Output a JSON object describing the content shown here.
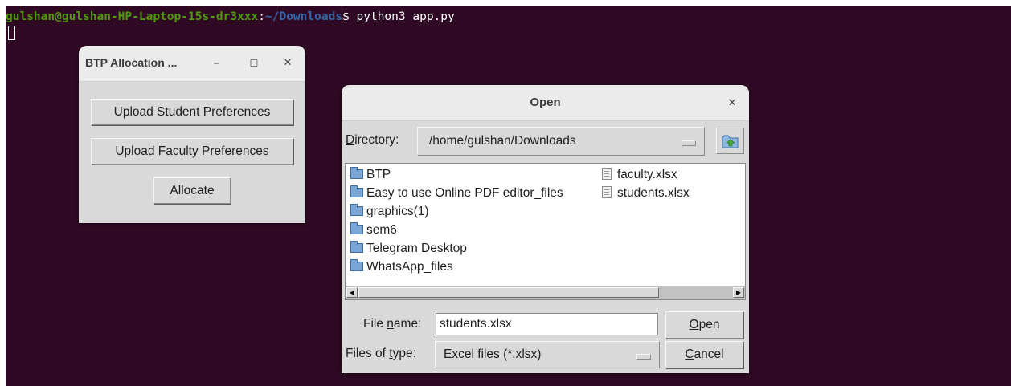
{
  "terminal": {
    "prompt_user": "gulshan@gulshan-HP-Laptop-15s-dr3xxx",
    "prompt_sep": ":",
    "prompt_path": "~/Downloads",
    "prompt_symbol": "$ ",
    "command": "python3 app.py",
    "colors": {
      "background": "#300a24",
      "user": "#4e9a06",
      "path": "#3465a4"
    }
  },
  "btp_window": {
    "title": "BTP Allocation ...",
    "minimize_glyph": "–",
    "maximize_glyph": "☐",
    "close_glyph": "✕",
    "upload_student_label": "Upload Student Preferences",
    "upload_faculty_label": "Upload Faculty Preferences",
    "allocate_label": "Allocate"
  },
  "open_dialog": {
    "title": "Open",
    "close_glyph": "✕",
    "directory_label_u": "D",
    "directory_label_rest": "irectory:",
    "directory_value": "/home/gulshan/Downloads",
    "up_icon": "folder-up-icon",
    "folders": [
      "BTP",
      "Easy to use Online PDF editor_files",
      "graphics(1)",
      "sem6",
      "Telegram Desktop",
      "WhatsApp_files"
    ],
    "files": [
      "faculty.xlsx",
      "students.xlsx"
    ],
    "filename_label_pre": "File ",
    "filename_label_u": "n",
    "filename_label_post": "ame:",
    "filename_value": "students.xlsx",
    "filetype_label_pre": "Files of ",
    "filetype_label_u": "t",
    "filetype_label_post": "ype:",
    "filetype_value": "Excel files (*.xlsx)",
    "open_u": "O",
    "open_rest": "pen",
    "cancel_u": "C",
    "cancel_rest": "ancel",
    "scroll_left_glyph": "◀",
    "scroll_right_glyph": "▶"
  }
}
